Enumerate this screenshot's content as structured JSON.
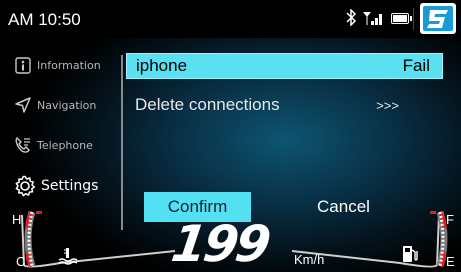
{
  "statusbar": {
    "time": "AM 10:50",
    "icons": [
      "bluetooth-icon",
      "signal-icon",
      "battery-icon",
      "brand-logo"
    ]
  },
  "sidebar": {
    "items": [
      {
        "label": "Information",
        "icon": "info-icon",
        "active": false
      },
      {
        "label": "Navigation",
        "icon": "navigation-arrow-icon",
        "active": false
      },
      {
        "label": "Telephone",
        "icon": "phone-icon",
        "active": false
      },
      {
        "label": "Settings",
        "icon": "gear-icon",
        "active": true
      }
    ]
  },
  "list": {
    "rows": [
      {
        "name": "iphone",
        "status": "Fail",
        "selected": true
      },
      {
        "name": "Delete connections",
        "status": ">>>",
        "selected": false
      }
    ]
  },
  "dialog": {
    "confirm_label": "Confirm",
    "cancel_label": "Cancel"
  },
  "cluster": {
    "speed": "199",
    "speed_unit": "Km/h",
    "temp_high_label": "H",
    "temp_low_label": "C",
    "fuel_full_label": "F",
    "fuel_empty_label": "E"
  },
  "colors": {
    "accent": "#53e0f2",
    "warning": "#e02020",
    "background": "#000000"
  }
}
